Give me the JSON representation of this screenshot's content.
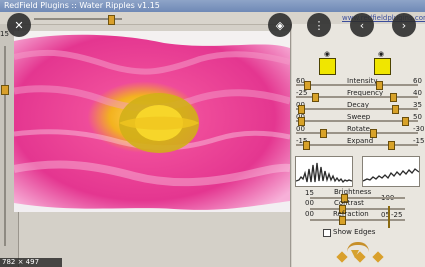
{
  "window": {
    "title": "RedField Plugins :: Water Ripples v1.15"
  },
  "header": {
    "website": "www.redfieldplugins.com"
  },
  "left": {
    "value": "15"
  },
  "overlay": {
    "size": "782 × 497"
  },
  "controls": {
    "intensity": {
      "label": "Intensity",
      "min": "60",
      "max": "60"
    },
    "frequency": {
      "label": "Frequency",
      "min": "-25",
      "max": "40"
    },
    "decay": {
      "label": "Decay",
      "min": "00",
      "max": "35"
    },
    "sweep": {
      "label": "Sweep",
      "min": "00",
      "max": "50"
    },
    "rotate": {
      "label": "Rotate",
      "min": "00",
      "max": "-30"
    },
    "expand": {
      "label": "Expand",
      "min": "-15",
      "max": "-15"
    },
    "brightness": {
      "label": "Brightness",
      "min": "15",
      "max": "100"
    },
    "contrast": {
      "label": "Contrast",
      "min": "00",
      "max": ""
    },
    "refraction": {
      "label": "Refraction",
      "min": "00",
      "max": "05"
    },
    "extra": {
      "value": "-25"
    },
    "show_edges": {
      "label": "Show Edges"
    }
  }
}
